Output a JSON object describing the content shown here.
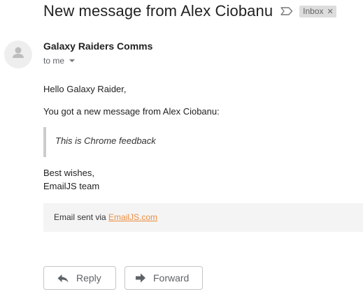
{
  "email": {
    "subject": "New message from Alex Ciobanu",
    "label": "Inbox",
    "sender": "Galaxy Raiders Comms",
    "recipient": "to me",
    "greeting": "Hello Galaxy Raider,",
    "intro": "You got a new message from Alex Ciobanu:",
    "quote": "This is Chrome feedback",
    "signoff": "Best wishes,",
    "signature": "EmailJS team",
    "footer_prefix": "Email sent via ",
    "footer_link": "EmailJS.com"
  },
  "actions": {
    "reply_label": "Reply",
    "forward_label": "Forward"
  },
  "icons": {
    "importance": "importance-marker-icon",
    "label_remove": "close-icon",
    "avatar": "person-icon",
    "reply": "reply-arrow-icon",
    "forward": "forward-arrow-icon",
    "recipient_details": "caret-down-icon"
  },
  "colors": {
    "link": "#ec8d3f",
    "chip_bg": "#dddddd",
    "footer_bg": "#f4f4f4",
    "quote_border": "#cccccc"
  }
}
